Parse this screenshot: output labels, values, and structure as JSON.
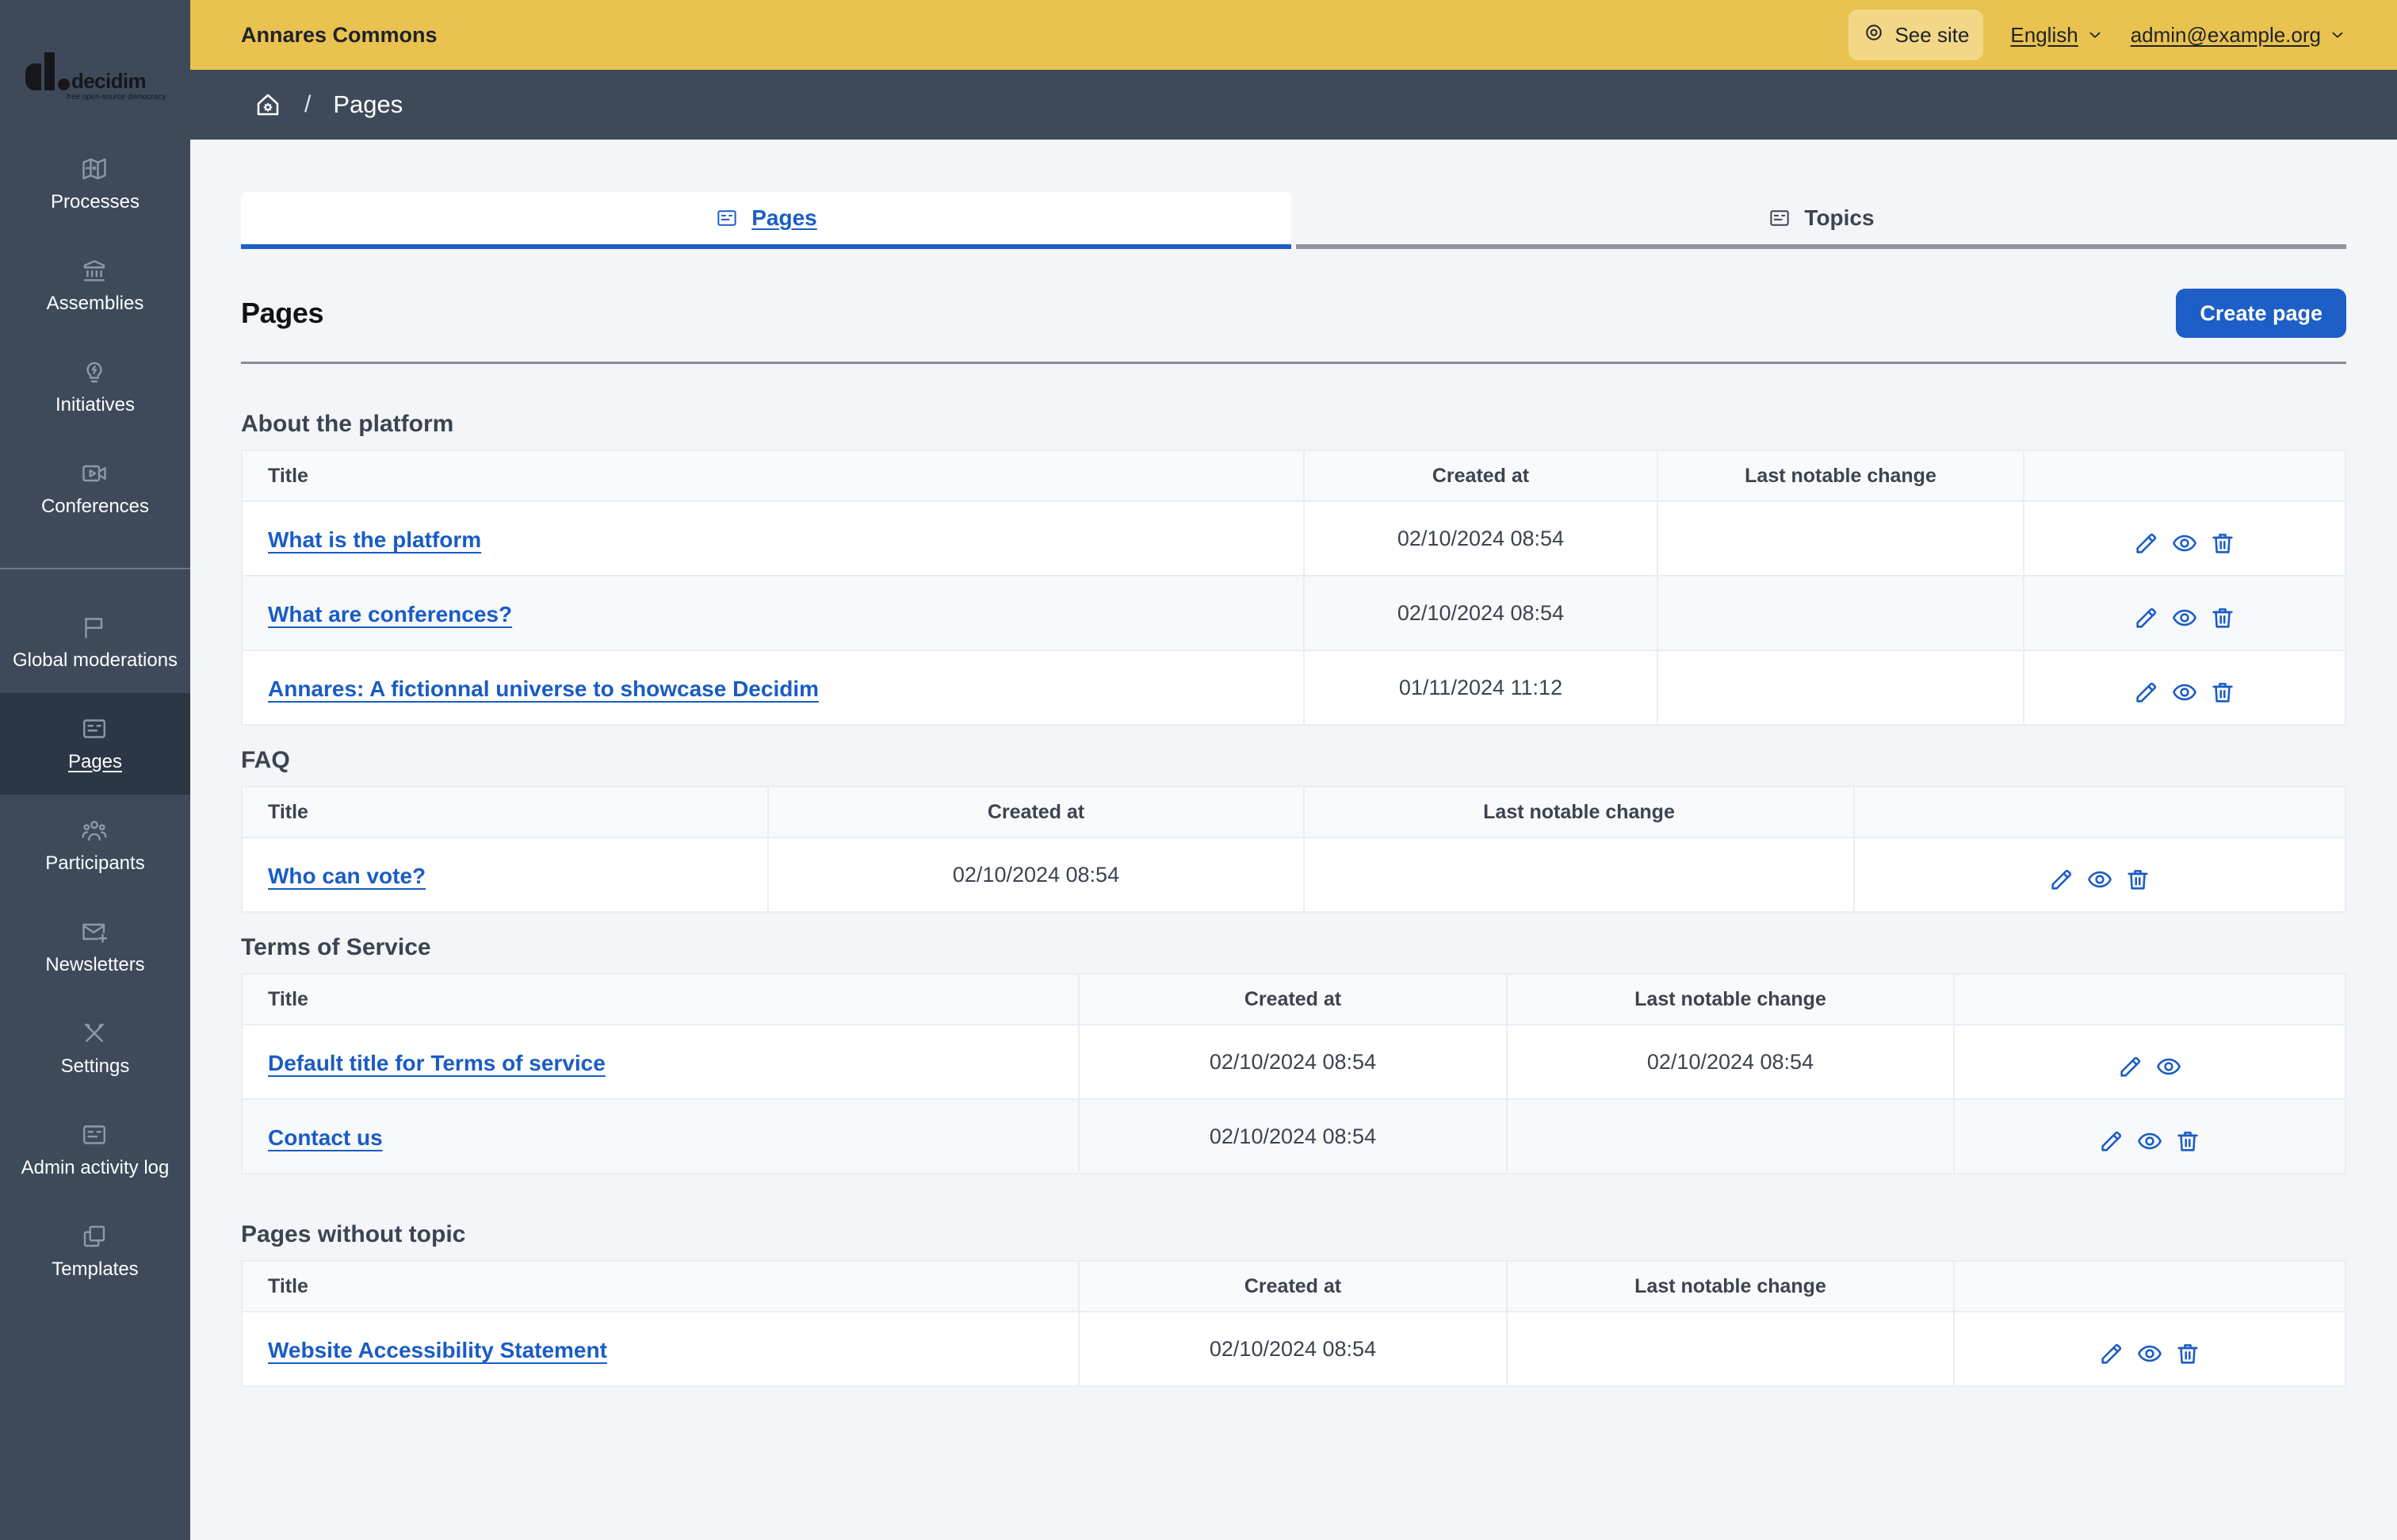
{
  "topbar": {
    "title": "Annares Commons",
    "see_site_label": "See site",
    "language_label": "English",
    "account_label": "admin@example.org"
  },
  "breadcrumb": {
    "separator": "/",
    "current": "Pages"
  },
  "sidebar": {
    "logo_name": "decidim",
    "logo_tagline": "free open-source democracy",
    "groups": [
      {
        "items": [
          {
            "label": "Processes",
            "icon": "map",
            "active": false
          },
          {
            "label": "Assemblies",
            "icon": "bank",
            "active": false
          },
          {
            "label": "Initiatives",
            "icon": "bulb",
            "active": false
          },
          {
            "label": "Conferences",
            "icon": "video",
            "active": false
          }
        ]
      },
      {
        "items": [
          {
            "label": "Global moderations",
            "icon": "flag",
            "active": false
          },
          {
            "label": "Pages",
            "icon": "card",
            "active": true
          },
          {
            "label": "Participants",
            "icon": "group",
            "active": false
          },
          {
            "label": "Newsletters",
            "icon": "mailplus",
            "active": false
          },
          {
            "label": "Settings",
            "icon": "tools",
            "active": false
          },
          {
            "label": "Admin activity log",
            "icon": "card",
            "active": false
          },
          {
            "label": "Templates",
            "icon": "copy",
            "active": false
          }
        ]
      }
    ]
  },
  "tabs": [
    {
      "label": "Pages",
      "icon": "card",
      "active": true
    },
    {
      "label": "Topics",
      "icon": "card",
      "active": false
    }
  ],
  "page": {
    "title": "Pages",
    "create_button": "Create page"
  },
  "table_columns": [
    "Title",
    "Created at",
    "Last notable change"
  ],
  "sections": [
    {
      "id": "about",
      "heading": "About the platform",
      "rows": [
        {
          "title": "What is the platform",
          "created_at": "02/10/2024 08:54",
          "last_notable_change": "",
          "actions": [
            "edit",
            "preview",
            "delete"
          ]
        },
        {
          "title": "What are conferences?",
          "created_at": "02/10/2024 08:54",
          "last_notable_change": "",
          "actions": [
            "edit",
            "preview",
            "delete"
          ]
        },
        {
          "title": "Annares: A fictionnal universe to showcase Decidim",
          "created_at": "01/11/2024 11:12",
          "last_notable_change": "",
          "actions": [
            "edit",
            "preview",
            "delete"
          ]
        }
      ]
    },
    {
      "id": "faq",
      "heading": "FAQ",
      "rows": [
        {
          "title": "Who can vote?",
          "created_at": "02/10/2024 08:54",
          "last_notable_change": "",
          "actions": [
            "edit",
            "preview",
            "delete"
          ]
        }
      ]
    },
    {
      "id": "terms",
      "heading": "Terms of Service",
      "rows": [
        {
          "title": "Default title for Terms of service",
          "created_at": "02/10/2024 08:54",
          "last_notable_change": "02/10/2024 08:54",
          "actions": [
            "edit",
            "preview"
          ]
        },
        {
          "title": "Contact us",
          "created_at": "02/10/2024 08:54",
          "last_notable_change": "",
          "actions": [
            "edit",
            "preview",
            "delete"
          ]
        }
      ]
    },
    {
      "id": "no_topic",
      "heading": "Pages without topic",
      "rows": [
        {
          "title": "Website Accessibility Statement",
          "created_at": "02/10/2024 08:54",
          "last_notable_change": "",
          "actions": [
            "edit",
            "preview",
            "delete"
          ]
        }
      ]
    }
  ],
  "colors": {
    "accent_yellow": "#e9c24f",
    "sidebar_slate": "#3e4a5a",
    "primary_blue": "#1d5ec7",
    "link_blue": "#1a5cc5"
  }
}
